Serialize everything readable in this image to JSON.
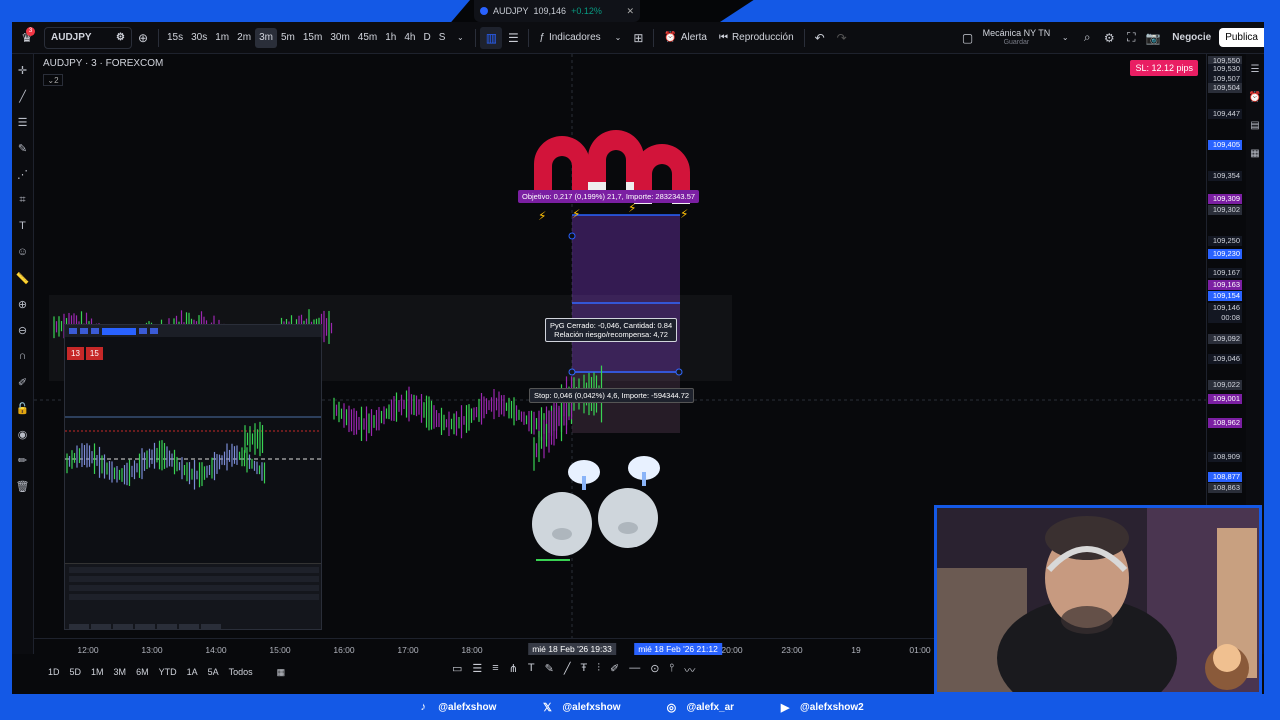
{
  "browser_tab": {
    "symbol": "AUDJPY",
    "price": "109,146",
    "change": "+0.12%"
  },
  "toolbar": {
    "notification_count": "3",
    "symbol": "AUDJPY",
    "intervals": [
      "15s",
      "30s",
      "1m",
      "2m",
      "3m",
      "5m",
      "15m",
      "30m",
      "45m",
      "1h",
      "4h",
      "D",
      "S"
    ],
    "active_interval": "3m",
    "indicators_label": "Indicadores",
    "alert_label": "Alerta",
    "replay_label": "Reproducción",
    "layout_name": "Mecánica NY TN",
    "layout_sub": "Guardar",
    "trade_label": "Negocie",
    "publish_label": "Publica"
  },
  "chart": {
    "title": "AUDJPY · 3 · FOREXCOM",
    "collapse_label": "2",
    "sl_badge": "SL: 12.12 pips",
    "target_tooltip": "Objetivo: 0,217 (0,199%) 21,7, Importe: 2832343.57",
    "pnl_tooltip_line1": "PyG Cerrado: -0,046, Cantidad: 0.84",
    "pnl_tooltip_line2": "Relación riesgo/recompensa: 4,72",
    "stop_tooltip": "Stop: 0,046 (0,042%) 4,6, Importe: -594344.72"
  },
  "price_scale": [
    {
      "value": "109,550",
      "style": "grey",
      "y": 0
    },
    {
      "value": "109,530",
      "style": "dark",
      "y": 1
    },
    {
      "value": "109,507",
      "style": "dark",
      "y": 2
    },
    {
      "value": "109,504",
      "style": "grey",
      "y": 3
    },
    {
      "value": "109,447",
      "style": "dark",
      "y": 4
    },
    {
      "value": "109,405",
      "style": "blue",
      "y": 5
    },
    {
      "value": "109,354",
      "style": "dark",
      "y": 6
    },
    {
      "value": "109,309",
      "style": "purple",
      "y": 7
    },
    {
      "value": "109,302",
      "style": "grey",
      "y": 8
    },
    {
      "value": "109,250",
      "style": "dark",
      "y": 9
    },
    {
      "value": "109,230",
      "style": "blue",
      "y": 10
    },
    {
      "value": "109,167",
      "style": "dark",
      "y": 11
    },
    {
      "value": "109,163",
      "style": "purple",
      "y": 12
    },
    {
      "value": "109,154",
      "style": "blue",
      "y": 13
    },
    {
      "value": "109,146",
      "style": "dark",
      "y": 14
    },
    {
      "value": "00:08",
      "style": "dark",
      "y": 15
    },
    {
      "value": "109,092",
      "style": "grey",
      "y": 16
    },
    {
      "value": "109,046",
      "style": "dark",
      "y": 17
    },
    {
      "value": "109,022",
      "style": "grey",
      "y": 18
    },
    {
      "value": "109,001",
      "style": "purple",
      "y": 19
    },
    {
      "value": "108,962",
      "style": "purple",
      "y": 20
    },
    {
      "value": "108,909",
      "style": "dark",
      "y": 21
    },
    {
      "value": "108,877",
      "style": "blue",
      "y": 22
    },
    {
      "value": "108,863",
      "style": "grey",
      "y": 23
    }
  ],
  "time_axis": {
    "labels": [
      "12:00",
      "13:00",
      "14:00",
      "15:00",
      "16:00",
      "17:00",
      "18:00",
      "20:00",
      "23:00",
      "19",
      "01:00"
    ],
    "cursor_start": "mié 18 Feb '26  19:33",
    "cursor_end": "mié 18 Feb '26  21:12"
  },
  "bottom_ranges": [
    "1D",
    "5D",
    "1M",
    "3M",
    "6M",
    "YTD",
    "1A",
    "5A",
    "Todos"
  ],
  "mt5": {
    "bid": "13",
    "ask": "15"
  },
  "social": [
    {
      "icon": "tiktok-icon",
      "handle": "@alefxshow"
    },
    {
      "icon": "x-icon",
      "handle": "@alefxshow"
    },
    {
      "icon": "instagram-icon",
      "handle": "@alefx_ar"
    },
    {
      "icon": "youtube-icon",
      "handle": "@alefxshow2"
    }
  ],
  "colors": {
    "accent": "#1459e6",
    "target": "#7b1fa2",
    "stop_badge": "#e91e63",
    "bull": "#39d353",
    "bear": "#9c27b0"
  }
}
